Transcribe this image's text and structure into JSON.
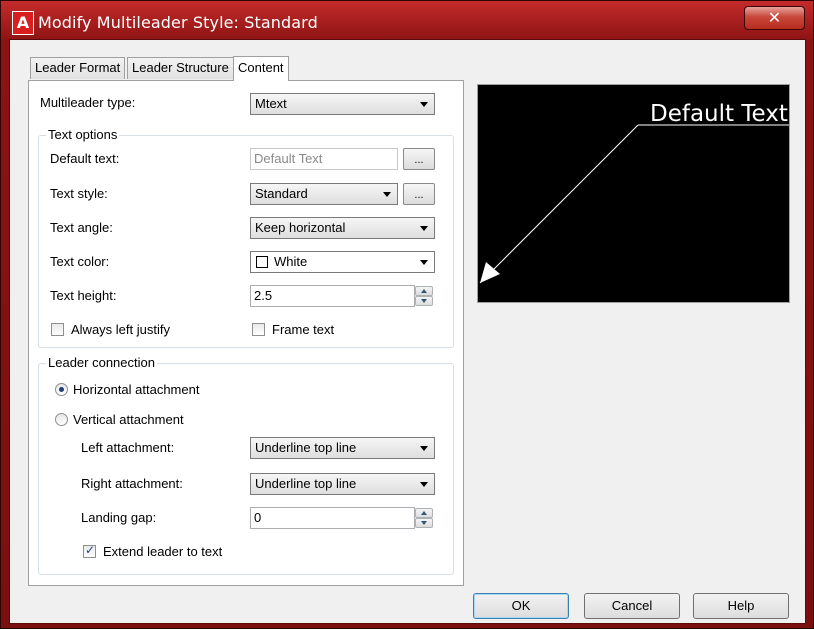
{
  "window": {
    "title": "Modify Multileader Style: Standard",
    "app_icon_letter": "A",
    "close_glyph": "✕"
  },
  "tabs": [
    {
      "label": "Leader Format",
      "active": false
    },
    {
      "label": "Leader Structure",
      "active": false
    },
    {
      "label": "Content",
      "active": true
    }
  ],
  "content": {
    "multileader_type_label": "Multileader type:",
    "multileader_type_value": "Mtext",
    "text_options": {
      "title": "Text options",
      "default_text_label": "Default text:",
      "default_text_value": "Default Text",
      "browse_label": "...",
      "text_style_label": "Text style:",
      "text_style_value": "Standard",
      "text_angle_label": "Text angle:",
      "text_angle_value": "Keep horizontal",
      "text_color_label": "Text color:",
      "text_color_value": "White",
      "text_color_swatch": "#ffffff",
      "text_height_label": "Text height:",
      "text_height_value": "2.5",
      "always_left_justify_label": "Always left justify",
      "always_left_justify_checked": false,
      "frame_text_label": "Frame text",
      "frame_text_checked": false
    },
    "leader_connection": {
      "title": "Leader connection",
      "horizontal_label": "Horizontal attachment",
      "horizontal_selected": true,
      "vertical_label": "Vertical attachment",
      "vertical_selected": false,
      "left_attachment_label": "Left attachment:",
      "left_attachment_value": "Underline top line",
      "right_attachment_label": "Right attachment:",
      "right_attachment_value": "Underline top line",
      "landing_gap_label": "Landing gap:",
      "landing_gap_value": "0",
      "extend_leader_label": "Extend leader to text",
      "extend_leader_checked": true
    }
  },
  "preview": {
    "text": "Default Text",
    "background": "#000000",
    "foreground": "#ffffff"
  },
  "buttons": {
    "ok": "OK",
    "cancel": "Cancel",
    "help": "Help"
  }
}
